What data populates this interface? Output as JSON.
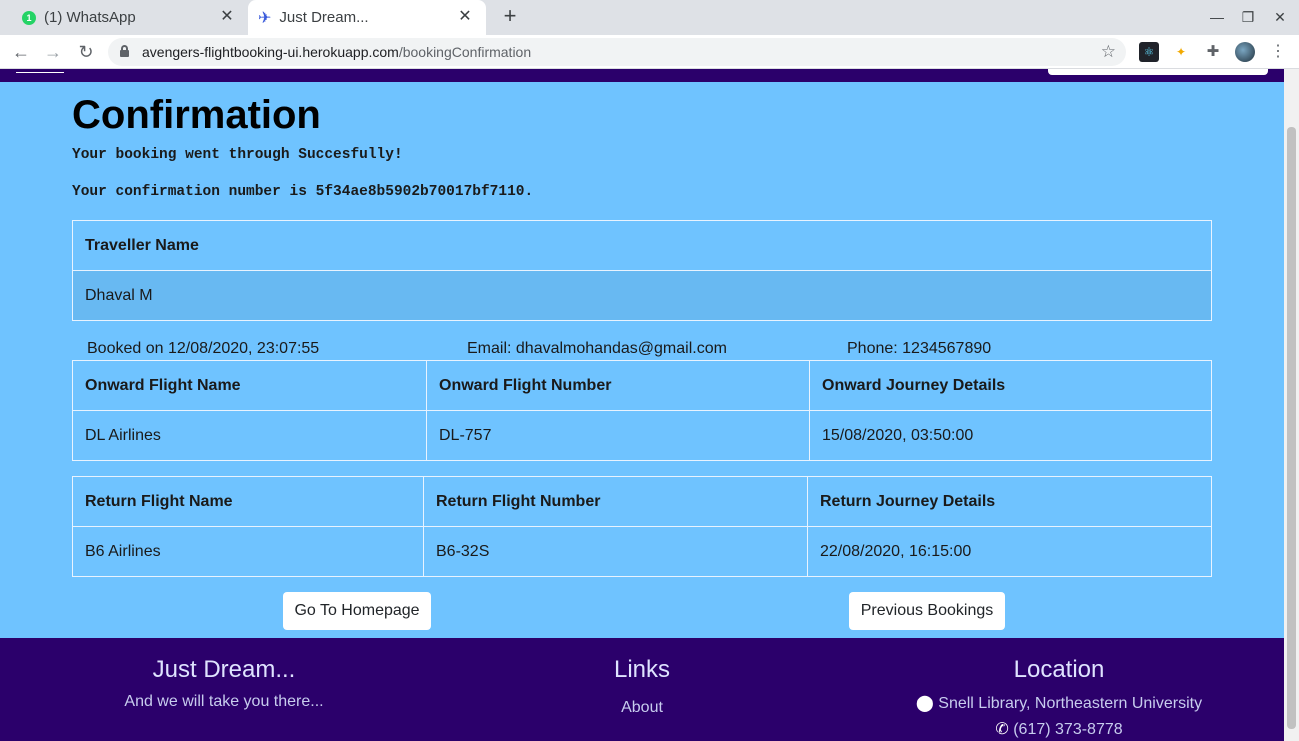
{
  "browser": {
    "tabs": [
      {
        "title": "(1) WhatsApp",
        "badge": "1"
      },
      {
        "title": "Just Dream..."
      }
    ],
    "new_tab_label": "+",
    "url_host": "avengers-flightbooking-ui.herokuapp.com",
    "url_path": "/bookingConfirmation"
  },
  "page": {
    "title": "Confirmation",
    "success_message": "Your booking went through Succesfully!",
    "confirmation_message": "Your confirmation number is 5f34ae8b5902b70017bf7110.",
    "traveller": {
      "header": "Traveller Name",
      "name": "Dhaval M"
    },
    "booked_on": "Booked on 12/08/2020, 23:07:55",
    "email": "Email: dhavalmohandas@gmail.com",
    "phone": "Phone: 1234567890",
    "onward": {
      "headers": [
        "Onward Flight Name",
        "Onward Flight Number",
        "Onward Journey Details"
      ],
      "values": [
        "DL Airlines",
        "DL-757",
        "15/08/2020, 03:50:00"
      ]
    },
    "return": {
      "headers": [
        "Return Flight Name",
        "Return Flight Number",
        "Return Journey Details"
      ],
      "values": [
        "B6 Airlines",
        "B6-32S",
        "22/08/2020, 16:15:00"
      ]
    },
    "buttons": {
      "home": "Go To Homepage",
      "previous": "Previous Bookings"
    },
    "colors": {
      "page_bg": "#6fc3ff",
      "nav_bg": "#2b006b"
    }
  },
  "footer": {
    "brand": {
      "title": "Just Dream...",
      "tagline": "And we will take you there..."
    },
    "links": {
      "title": "Links",
      "items": [
        "About"
      ]
    },
    "location": {
      "title": "Location",
      "address": "Snell Library, Northeastern University",
      "phone": "(617) 373-8778"
    }
  }
}
